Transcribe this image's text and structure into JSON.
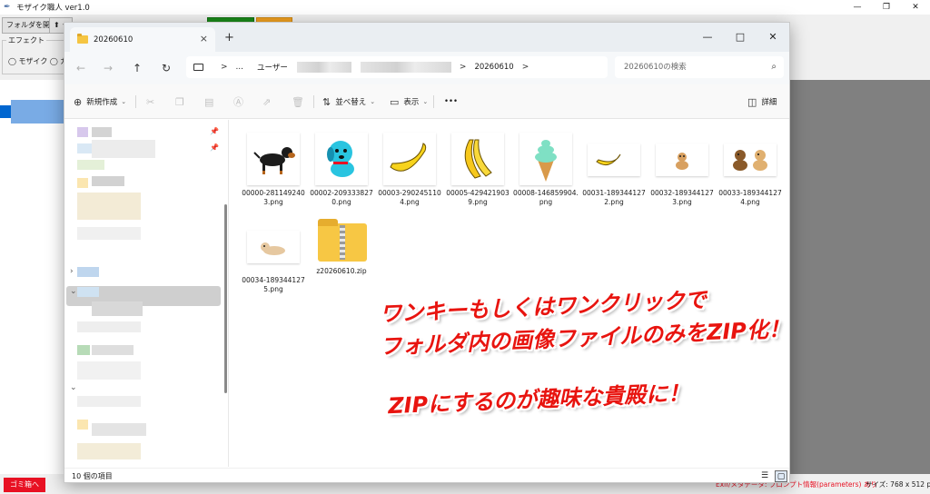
{
  "bg_app": {
    "title": "モザイク職人 ver1.0",
    "toolbar": {
      "open_folder": "フォルダを開く",
      "partial_label": "⬆ ★"
    },
    "effect_group": {
      "legend": "エフェクト",
      "mosaic_radio": "モザイク",
      "second_radio_partial": "ガ"
    },
    "status": {
      "trash_button": "ゴミ箱へ",
      "meta_text": "Exif/メタデータ: プロンプト情報(parameters) あり",
      "size_text": "サイズ: 768 x 512 px"
    },
    "colors": {
      "trash": "#e81123",
      "green_btn": "#1a8a1a",
      "orange_btn": "#f0a020",
      "canvas_gray": "#808080"
    }
  },
  "explorer": {
    "tab_label": "20260610",
    "tab_close": "×",
    "new_tab": "+",
    "window_controls": [
      "—",
      "□",
      "✕"
    ],
    "nav_icons": [
      "arrow-left",
      "arrow-right",
      "arrow-up",
      "refresh"
    ],
    "address": {
      "ellipsis": "…",
      "user_segment": "ユーザー",
      "current": "20260610",
      "sep": ">"
    },
    "search_placeholder": "20260610の検索",
    "commands": {
      "new": "新規作成",
      "sort": "並べ替え",
      "view": "表示",
      "more": "•••",
      "details": "詳細"
    },
    "files": [
      {
        "name": "00000-2811492403.png",
        "icon": "dog-icon"
      },
      {
        "name": "00002-2093338270.png",
        "icon": "dog-icon"
      },
      {
        "name": "00003-2902451104.png",
        "icon": "banana-icon"
      },
      {
        "name": "00005-4294219039.png",
        "icon": "banana-icon"
      },
      {
        "name": "00008-146859904.png",
        "icon": "ice-cream-icon"
      },
      {
        "name": "00031-1893441272.png",
        "icon": "banana-icon"
      },
      {
        "name": "00032-1893441273.png",
        "icon": "dog-icon"
      },
      {
        "name": "00033-1893441274.png",
        "icon": "dog-icon"
      },
      {
        "name": "00034-1893441275.png",
        "icon": "dog-icon"
      },
      {
        "name": "z20260610.zip",
        "icon": "zip-folder-icon"
      }
    ],
    "status_count": "10 個の項目"
  },
  "promo": {
    "line1": "ワンキーもしくはワンクリックで",
    "line2": "フォルダ内の画像ファイルのみをZIP化！",
    "line3": "ZIPにするのが趣味な貴殿に！",
    "color": "#e8140f"
  }
}
